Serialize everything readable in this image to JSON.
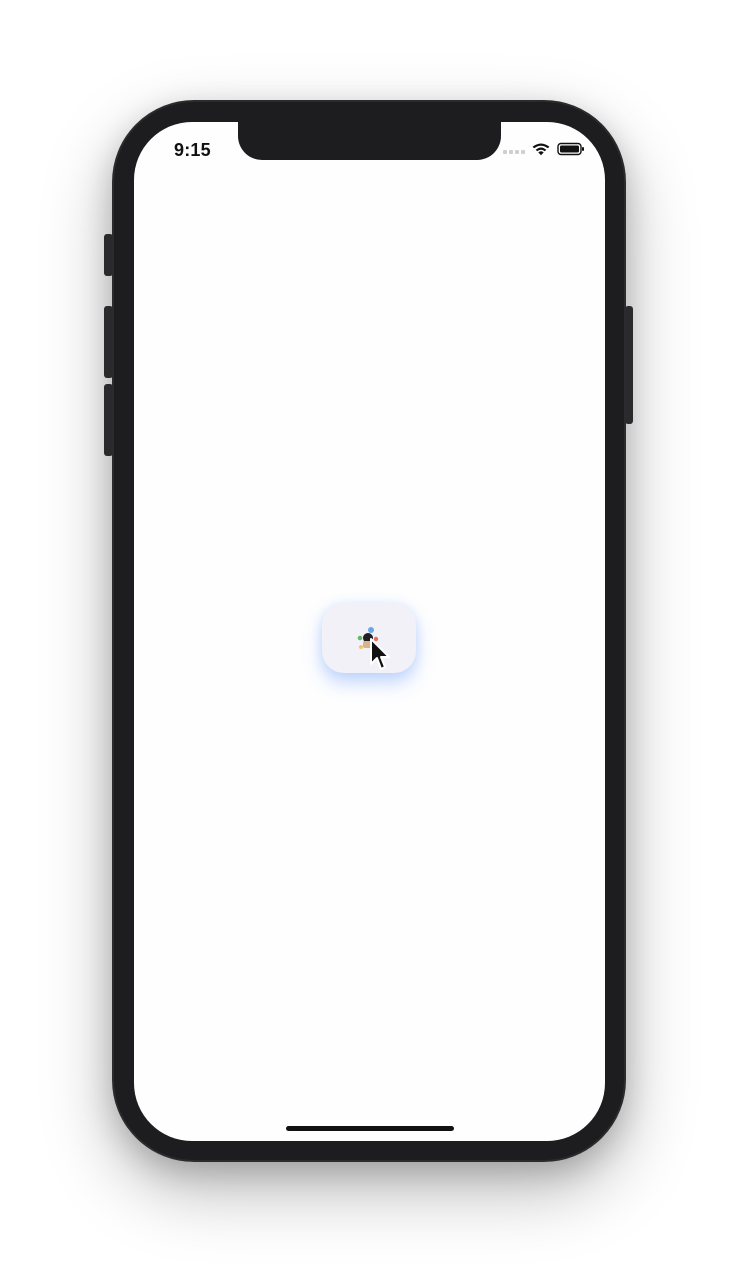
{
  "status_bar": {
    "time": "9:15"
  },
  "icons": {
    "signal": "cellular-signal-icon",
    "wifi": "wifi-icon",
    "battery": "battery-icon",
    "app": "app-icon",
    "cursor": "mouse-cursor-icon"
  },
  "colors": {
    "phone_frame": "#1d1d1f",
    "screen_background": "#fefefe",
    "card_background": "#f1f1f7",
    "card_glow": "#5690ff"
  }
}
